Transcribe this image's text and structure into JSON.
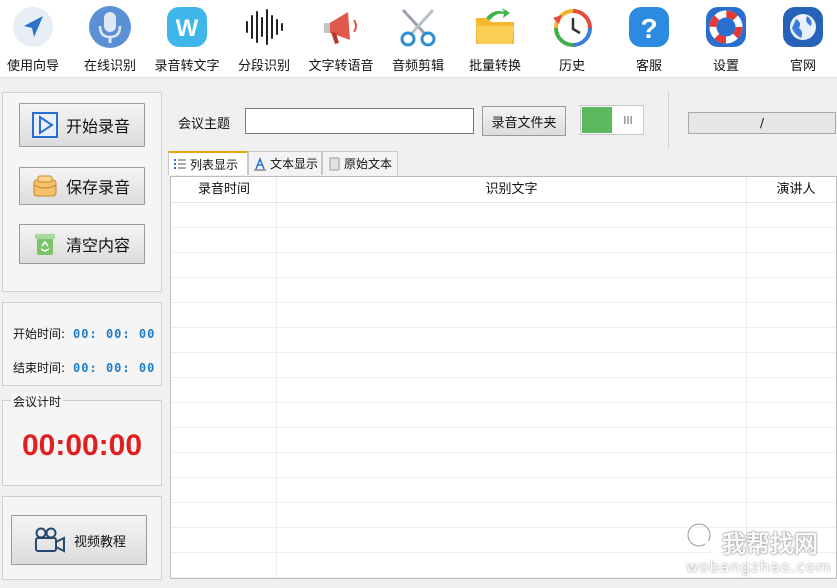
{
  "toolbar": {
    "items": [
      {
        "label": "使用向导",
        "icon": "guide-arrow-icon"
      },
      {
        "label": "在线识别",
        "icon": "microphone-icon"
      },
      {
        "label": "录音转文字",
        "icon": "w-badge-icon"
      },
      {
        "label": "分段识别",
        "icon": "waveform-icon"
      },
      {
        "label": "文字转语音",
        "icon": "megaphone-icon"
      },
      {
        "label": "音频剪辑",
        "icon": "scissors-icon"
      },
      {
        "label": "批量转换",
        "icon": "folder-arrow-icon"
      },
      {
        "label": "历史",
        "icon": "history-clock-icon"
      },
      {
        "label": "客服",
        "icon": "help-question-icon"
      },
      {
        "label": "设置",
        "icon": "lifebuoy-icon"
      },
      {
        "label": "官网",
        "icon": "globe-icon"
      }
    ]
  },
  "left": {
    "start_record": "开始录音",
    "save_record": "保存录音",
    "clear_content": "清空内容",
    "start_time_label": "开始时间:",
    "start_time_value": "00: 00: 00",
    "end_time_label": "结束时间:",
    "end_time_value": "00: 00: 00",
    "timer_title": "会议计时",
    "timer_value": "00:00:00",
    "video_tutorial": "视频教程"
  },
  "controls": {
    "topic_label": "会议主题",
    "topic_value": "",
    "folder_button": "录音文件夹",
    "toggle_on": true,
    "progress_text": "/"
  },
  "tabs": [
    {
      "label": "列表显示",
      "active": true
    },
    {
      "label": "文本显示",
      "active": false
    },
    {
      "label": "原始文本",
      "active": false
    }
  ],
  "table": {
    "columns": [
      "录音时间",
      "识别文字",
      "演讲人"
    ],
    "rows": []
  },
  "watermark": {
    "text": "我帮找网",
    "url": "wobangzhao.com"
  },
  "colors": {
    "timer_red": "#e02020",
    "time_blue": "#1f7ec7",
    "toggle_green": "#5cb85c",
    "tab_accent": "#e8a317"
  }
}
